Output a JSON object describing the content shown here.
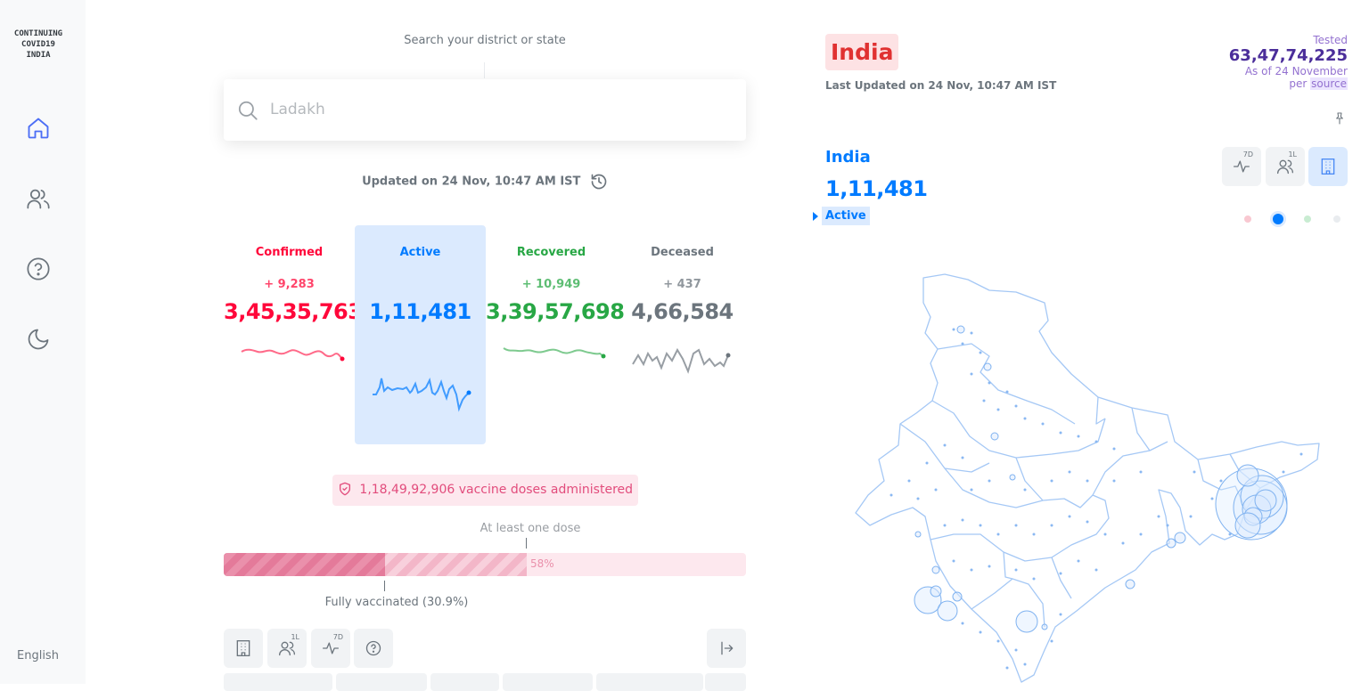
{
  "sidebar": {
    "brand": [
      "CONTINUING",
      "COVID19",
      "INDIA"
    ],
    "nav": [
      "home-icon",
      "users-icon",
      "help-icon",
      "moon-icon"
    ],
    "language": "English"
  },
  "search": {
    "caption": "Search your district or state",
    "placeholder": "Ladakh"
  },
  "updated": "Updated on 24 Nov, 10:47 AM IST",
  "levels": [
    {
      "label": "Confirmed",
      "delta": "+ 9,283",
      "value": "3,45,35,763",
      "color": "#ff073a"
    },
    {
      "label": "Active",
      "delta": "",
      "value": "1,11,481",
      "color": "#007bff"
    },
    {
      "label": "Recovered",
      "delta": "+ 10,949",
      "value": "3,39,57,698",
      "color": "#28a745"
    },
    {
      "label": "Deceased",
      "delta": "+ 437",
      "value": "4,66,584",
      "color": "#6c757d"
    }
  ],
  "vaccine": {
    "text": "1,18,49,92,906 vaccine doses administered",
    "at_least_one_label": "At least one dose",
    "at_least_one_pct_label": "58%",
    "at_least_one_fraction": 0.58,
    "fully_label": "Fully vaccinated (30.9%)",
    "fully_fraction": 0.309
  },
  "toolbar": {
    "buttons": [
      "building-icon",
      "population-icon",
      "pulse-icon",
      "help-icon"
    ],
    "sup_1L": "1L",
    "sup_7D": "7D",
    "right": "expand-icon"
  },
  "right": {
    "title": "India",
    "last_updated": "Last Updated on 24 Nov, 10:47 AM IST",
    "tested_label": "Tested",
    "tested_value": "63,47,74,225",
    "tested_asof": "As of 24 November",
    "tested_per": "per",
    "tested_source": "source",
    "map_name": "India",
    "map_value": "1,11,481",
    "map_statistic": "Active",
    "map_buttons_sup": [
      "7D",
      "1L"
    ],
    "dots": [
      "#f9c8d1",
      "#007bff",
      "#c9ecd2",
      "#e9ecef"
    ]
  }
}
